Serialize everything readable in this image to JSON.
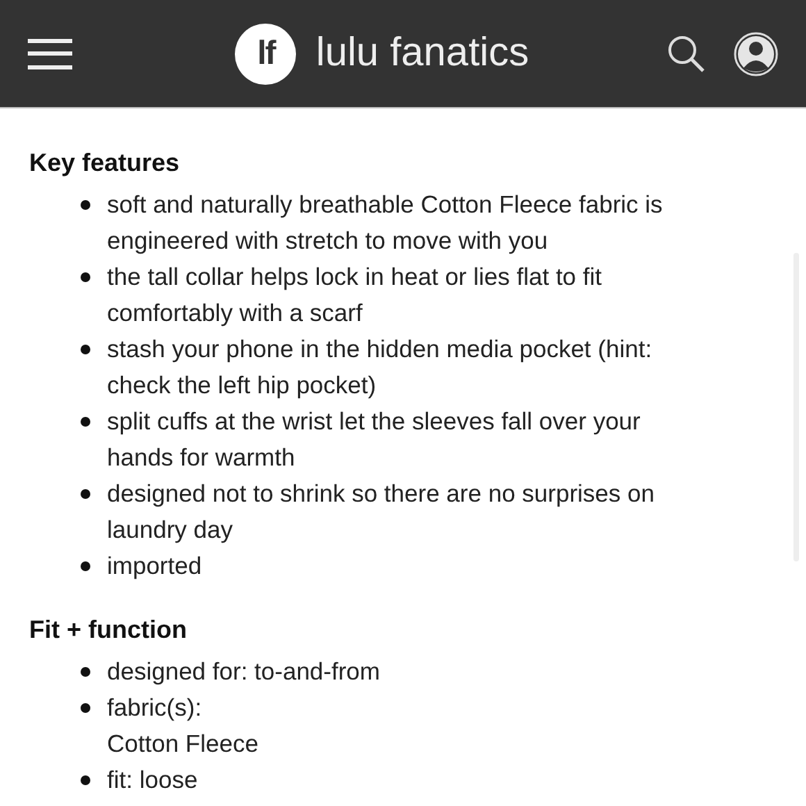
{
  "header": {
    "logo_mark": "lf",
    "brand": "lulu fanatics"
  },
  "sections": [
    {
      "heading": "Key features",
      "items": [
        {
          "lines": [
            "soft and naturally breathable Cotton Fleece fabric is",
            "engineered with stretch to move with you"
          ]
        },
        {
          "lines": [
            "the tall collar helps lock in heat or lies flat to fit",
            "comfortably with a scarf"
          ]
        },
        {
          "lines": [
            "stash your phone in the hidden media pocket (hint:",
            "check the left hip pocket)"
          ]
        },
        {
          "lines": [
            "split cuffs at the wrist let the sleeves fall over your",
            "hands for warmth"
          ]
        },
        {
          "lines": [
            "designed not to shrink so there are no surprises on",
            "laundry day"
          ]
        },
        {
          "lines": [
            "imported"
          ]
        }
      ]
    },
    {
      "heading": "Fit + function",
      "items": [
        {
          "lines": [
            "designed for: to-and-from"
          ]
        },
        {
          "lines": [
            "fabric(s):",
            "Cotton Fleece"
          ]
        },
        {
          "lines": [
            "fit: loose"
          ]
        }
      ]
    }
  ]
}
